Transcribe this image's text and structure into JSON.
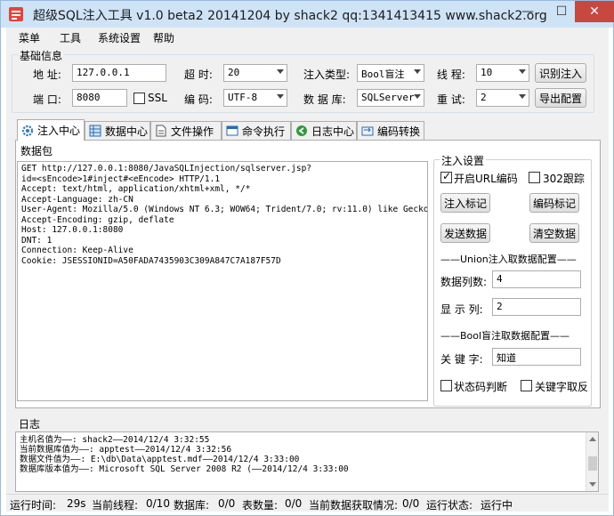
{
  "window": {
    "title": "超级SQL注入工具 v1.0 beta2 20141204 by shack2 qq:1341413415 www.shack2.org",
    "minimize": "—",
    "maximize": "☐",
    "close": "✕"
  },
  "menu": [
    "菜单",
    "工具",
    "系统设置",
    "帮助"
  ],
  "basic": {
    "group_title": "基础信息",
    "address_label": "地  址:",
    "address_value": "127.0.0.1",
    "port_label": "端  口:",
    "port_value": "8080",
    "ssl_label": "SSL",
    "timeout_label": "超  时:",
    "timeout_value": "20",
    "encoding_label": "编  码:",
    "encoding_value": "UTF-8",
    "inject_type_label": "注入类型:",
    "inject_type_value": "Bool盲注",
    "database_label": "数 据 库:",
    "database_value": "SQLServer",
    "threads_label": "线  程:",
    "threads_value": "10",
    "retry_label": "重  试:",
    "retry_value": "2",
    "identify_button": "识别注入",
    "export_button": "导出配置"
  },
  "tabs": [
    {
      "label": "注入中心",
      "icon": "gear-icon"
    },
    {
      "label": "数据中心",
      "icon": "grid-icon"
    },
    {
      "label": "文件操作",
      "icon": "file-icon"
    },
    {
      "label": "命令执行",
      "icon": "window-icon"
    },
    {
      "label": "日志中心",
      "icon": "back-arrow-icon"
    },
    {
      "label": "编码转换",
      "icon": "convert-icon"
    }
  ],
  "packet": {
    "title": "数据包",
    "lines": [
      "GET http://127.0.0.1:8080/JavaSQLInjection/sqlserver.jsp?",
      "id=<sEncode>1#inject#<eEncode> HTTP/1.1",
      "Accept: text/html, application/xhtml+xml, */*",
      "Accept-Language: zh-CN",
      "User-Agent: Mozilla/5.0 (Windows NT 6.3; WOW64; Trident/7.0; rv:11.0) like Gecko",
      "Accept-Encoding: gzip, deflate",
      "Host: 127.0.0.1:8080",
      "DNT: 1",
      "Connection: Keep-Alive",
      "Cookie: JSESSIONID=A50FADA7435903C309A847C7A187F57D"
    ]
  },
  "settings": {
    "title": "注入设置",
    "url_encode_label": "开启URL编码",
    "url_encode_checked": true,
    "redirect_label": "302跟踪",
    "redirect_checked": false,
    "inject_mark_button": "注入标记",
    "encode_mark_button": "编码标记",
    "send_button": "发送数据",
    "clear_button": "清空数据",
    "union_title": "——Union注入取数据配置——",
    "columns_label": "数据列数:",
    "columns_value": "4",
    "display_col_label": "显 示 列:",
    "display_col_value": "2",
    "bool_title": "——Bool盲注取数据配置——",
    "keyword_label": "关 键 字:",
    "keyword_value": "知道",
    "status_code_label": "状态码判断",
    "status_code_checked": false,
    "keyword_negate_label": "关键字取反",
    "keyword_negate_checked": false
  },
  "log": {
    "title": "日志",
    "lines": [
      "主机名值为——: shack2——2014/12/4 3:32:55",
      "当前数据库值为——: apptest——2014/12/4 3:32:56",
      "数据文件值为——: E:\\db\\Data\\apptest.mdf——2014/12/4 3:33:00",
      "数据库版本值为——: Microsoft SQL Server 2008 R2 (——2014/12/4 3:33:00"
    ]
  },
  "status": {
    "run_time_label": "运行时间:",
    "run_time_value": "29s",
    "threads_label": "当前线程:",
    "threads_value": "0/10",
    "db_label": "数据库:",
    "db_value": "0/0",
    "tables_label": "表数量:",
    "tables_value": "0/0",
    "fetch_label": "当前数据获取情况:",
    "fetch_value": "0/0",
    "run_state_label": "运行状态:",
    "run_state_value": "运行中"
  },
  "colors": {
    "title_bg": "#cfe3f7",
    "close_bg": "#c7483f",
    "window_bg": "#f0f0f0"
  }
}
